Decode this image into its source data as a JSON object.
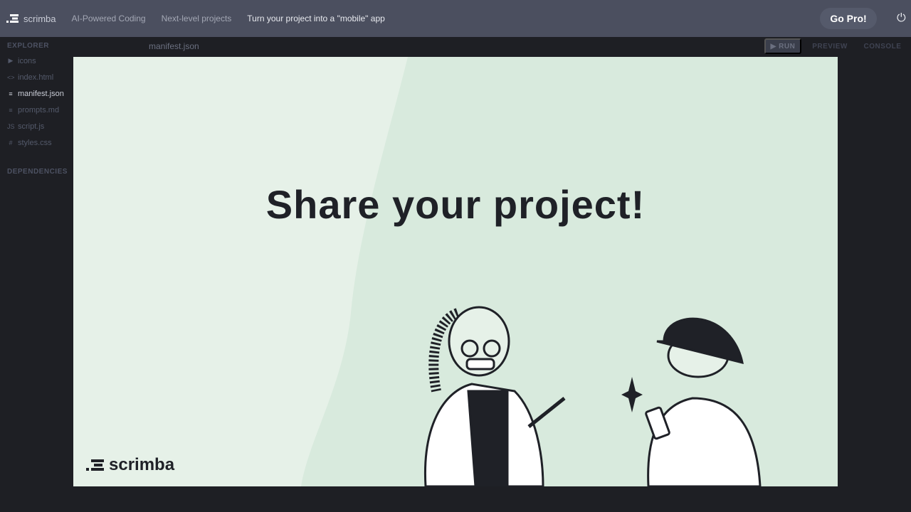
{
  "topbar": {
    "brand": "scrimba",
    "breadcrumbs": [
      "AI-Powered Coding",
      "Next-level projects",
      "Turn your project into a \"mobile\" app"
    ],
    "go_pro": "Go Pro!"
  },
  "sidebar": {
    "explorer": "EXPLORER",
    "files": [
      {
        "name": "icons",
        "icon": "folder-arrow-icon"
      },
      {
        "name": "index.html",
        "icon": "code-icon"
      },
      {
        "name": "manifest.json",
        "icon": "file-lines-icon"
      },
      {
        "name": "prompts.md",
        "icon": "file-lines-icon"
      },
      {
        "name": "script.js",
        "icon": "js-icon"
      },
      {
        "name": "styles.css",
        "icon": "hash-icon"
      }
    ],
    "dependencies": "DEPENDENCIES"
  },
  "editor": {
    "tab": "manifest.json",
    "run": "RUN",
    "preview": "PREVIEW",
    "console": "CONSOLE"
  },
  "slide": {
    "title": "Share your project!",
    "logo": "scrimba"
  },
  "colors": {
    "topbar": "#4b4f5f",
    "background": "#1e1f24",
    "slide": "#d8eadd"
  }
}
